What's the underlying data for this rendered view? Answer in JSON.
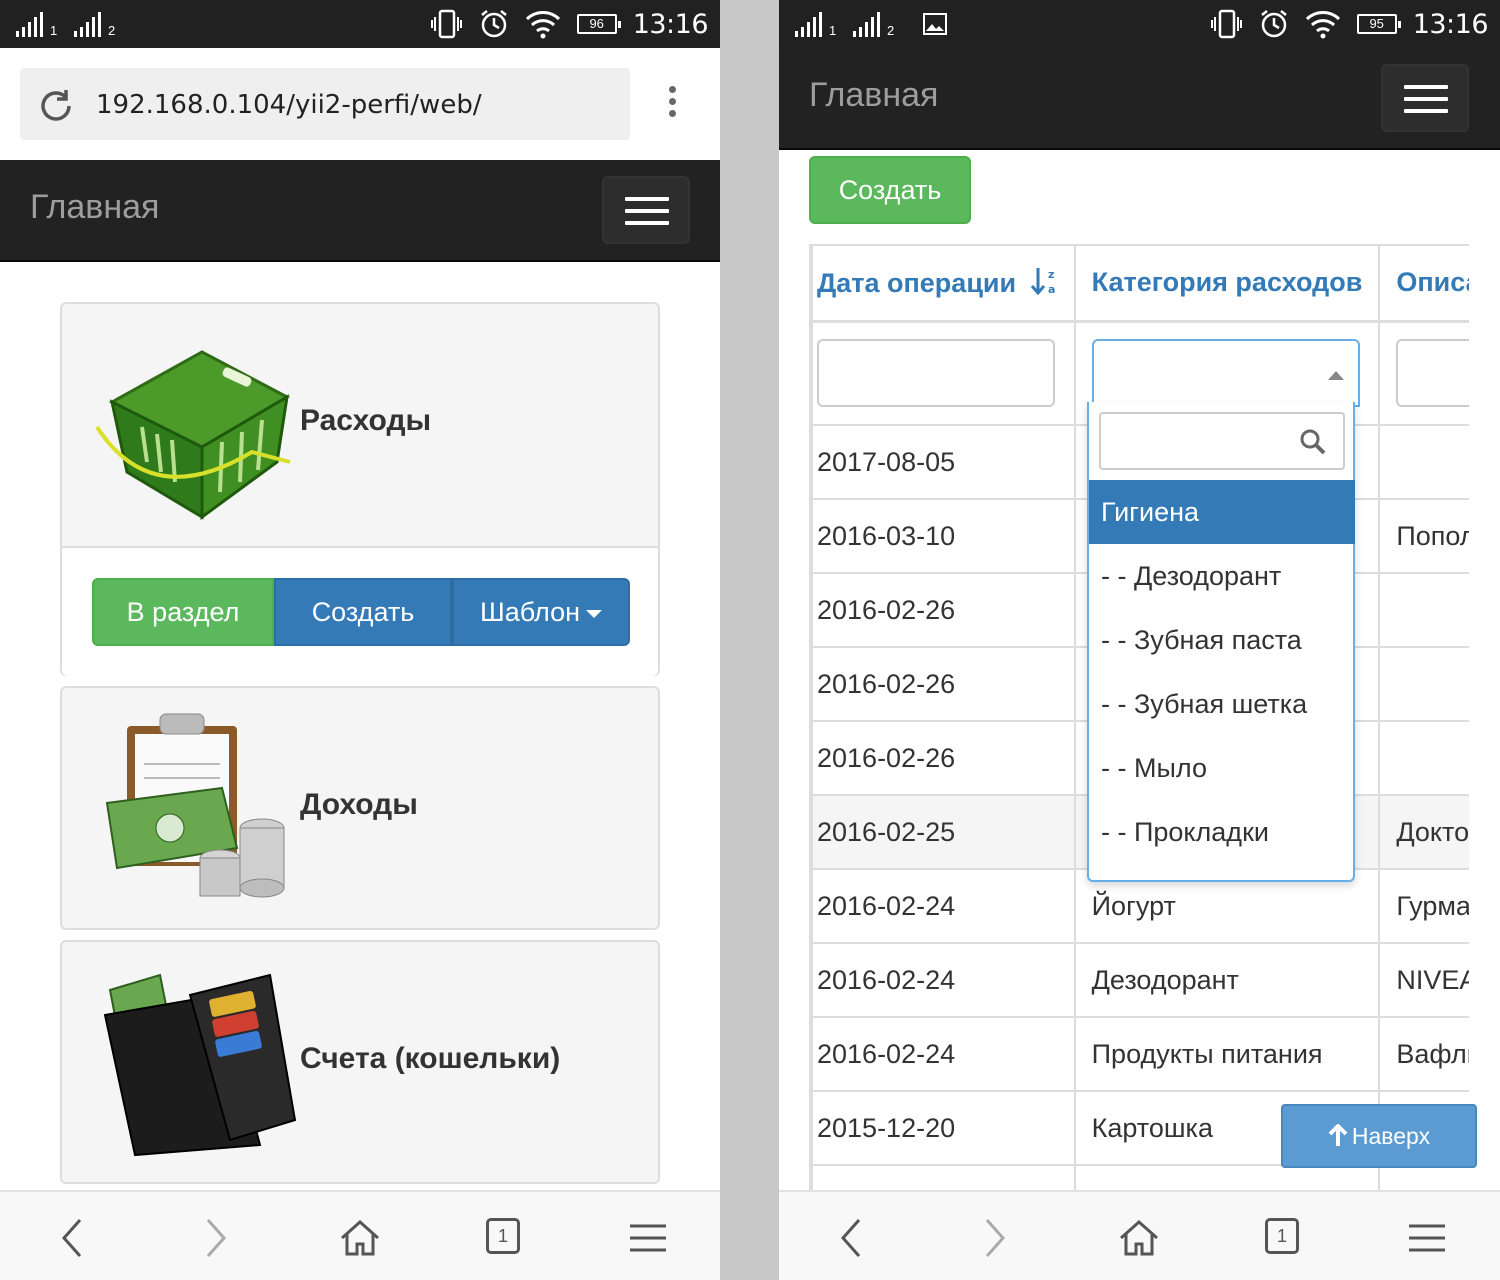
{
  "left": {
    "status": {
      "sim1": "1",
      "sim2": "2",
      "battery": "96",
      "time": "13:16"
    },
    "url": "192.168.0.104/yii2-perfi/web/",
    "brand": "Главная",
    "panels": [
      {
        "label": "Расходы",
        "icon": "shopping-basket-icon"
      },
      {
        "label": "Доходы",
        "icon": "money-clipboard-icon"
      },
      {
        "label": "Счета (кошельки)",
        "icon": "wallet-icon"
      }
    ],
    "buttons": {
      "section": "В раздел",
      "create": "Создать",
      "template": "Шаблон"
    }
  },
  "right": {
    "status": {
      "sim1": "1",
      "sim2": "2",
      "battery": "95",
      "time": "13:16"
    },
    "brand": "Главная",
    "create_label": "Создать",
    "columns": [
      "Дата операции",
      "Категория расходов",
      "Описа"
    ],
    "rows": [
      [
        "2017-08-05",
        "",
        ""
      ],
      [
        "2016-03-10",
        "",
        "Попол"
      ],
      [
        "2016-02-26",
        "",
        ""
      ],
      [
        "2016-02-26",
        "",
        ""
      ],
      [
        "2016-02-26",
        "",
        ""
      ],
      [
        "2016-02-25",
        "",
        "Докто"
      ],
      [
        "2016-02-24",
        "Йогурт",
        "Гурма"
      ],
      [
        "2016-02-24",
        "Дезодорант",
        "NIVEA"
      ],
      [
        "2016-02-24",
        "Продукты питания",
        "Вафли"
      ],
      [
        "2015-12-20",
        "Картошка",
        ""
      ],
      [
        "",
        "",
        ""
      ]
    ],
    "dropdown": [
      "Гигиена",
      "- - Дезодорант",
      "- - Зубная паста",
      "- - Зубная шетка",
      "- - Мыло",
      "- - Прокладки"
    ],
    "totop_label": "Наверх"
  },
  "bottom_nav": {
    "tabs_count": "1"
  },
  "colors": {
    "bootstrap_green": "#5cb85c",
    "bootstrap_blue": "#337ab7",
    "navbar": "#222222"
  }
}
